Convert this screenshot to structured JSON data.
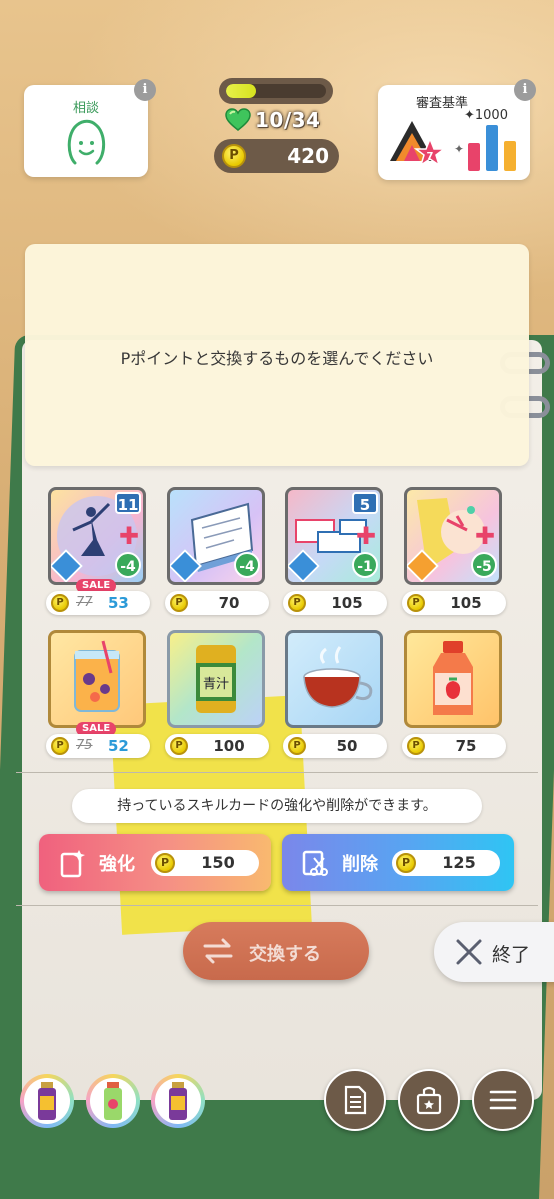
{
  "top": {
    "consult_label": "相談",
    "criteria_label": "審査基準",
    "criteria_bonus": "✦1000",
    "criteria_rank": "7",
    "hp_text": "10/34",
    "hp_fraction": 0.3,
    "points": "420"
  },
  "message": "Pポイントと交換するものを選んでください",
  "shop": {
    "row1": [
      {
        "level": "11",
        "cost": "-4",
        "sale": true,
        "sale_label": "SALE",
        "old_price": "77",
        "price": "53"
      },
      {
        "level": "",
        "cost": "-4",
        "sale": false,
        "price": "70"
      },
      {
        "level": "5",
        "cost": "-1",
        "sale": false,
        "price": "105"
      },
      {
        "level": "",
        "cost": "-5",
        "sale": false,
        "price": "105"
      }
    ],
    "row2": [
      {
        "sale": true,
        "sale_label": "SALE",
        "old_price": "75",
        "price": "52"
      },
      {
        "sale": false,
        "price": "100",
        "label": "青汁"
      },
      {
        "sale": false,
        "price": "50"
      },
      {
        "sale": false,
        "price": "75"
      }
    ]
  },
  "description": "持っているスキルカードの強化や削除ができます。",
  "actions": {
    "upgrade_label": "強化",
    "upgrade_cost": "150",
    "delete_label": "削除",
    "delete_cost": "125",
    "exchange_label": "交換する",
    "end_label": "終了"
  },
  "coin_glyph": "P",
  "info_glyph": "i"
}
